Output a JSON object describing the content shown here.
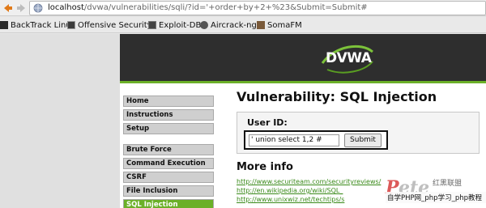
{
  "browser": {
    "url_host": "localhost",
    "url_path": "/dvwa/vulnerabilities/sqli/?id='+order+by+2+%23&Submit=Submit#"
  },
  "bookmarks": [
    {
      "label": "BackTrack Linux",
      "icon": "backtrack-icon"
    },
    {
      "label": "Offensive Security",
      "icon": "offensive-security-icon"
    },
    {
      "label": "Exploit-DB",
      "icon": "exploit-db-icon"
    },
    {
      "label": "Aircrack-ng",
      "icon": "aircrack-icon"
    },
    {
      "label": "SomaFM",
      "icon": "somafm-icon"
    }
  ],
  "dvwa": {
    "logo": "DVWA",
    "menu": {
      "group1": [
        "Home",
        "Instructions",
        "Setup"
      ],
      "group2": [
        "Brute Force",
        "Command Execution",
        "CSRF",
        "File Inclusion",
        "SQL Injection"
      ]
    },
    "page_title": "Vulnerability: SQL Injection",
    "user_id_label": "User ID:",
    "user_id_value": "' union select 1,2 #",
    "submit_label": "Submit",
    "more_info_heading": "More info",
    "links": [
      "http://www.securiteam.com/securityreviews/",
      "http://en.wikipedia.org/wiki/SQL_",
      "http://www.unixwiz.net/techtips/s"
    ],
    "accent_color": "#6bb028",
    "header_color": "#2e2e2e"
  },
  "watermark": {
    "top_text": "红黑联盟",
    "bottom_text": "自学PHP网_php学习_php教程"
  }
}
